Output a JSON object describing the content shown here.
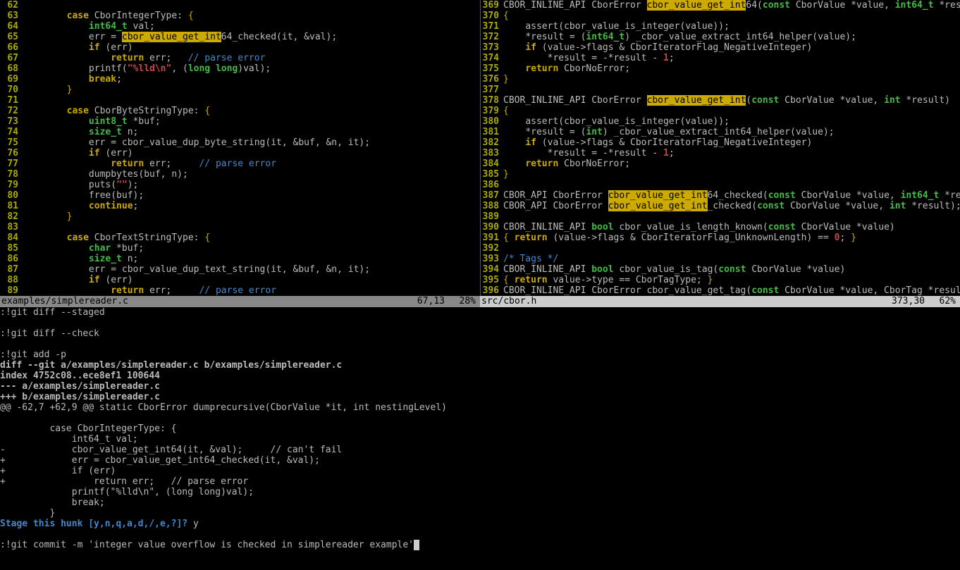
{
  "left": {
    "file": "examples/simplereader.c",
    "pos": "67,13",
    "pct": "28%",
    "lines": [
      {
        "n": 62,
        "t": ""
      },
      {
        "n": 63,
        "p": "        ",
        "tok": [
          [
            "c-keyword",
            "case"
          ],
          [
            "",
            " CborIntegerType: "
          ],
          [
            "c-paren",
            "{"
          ]
        ]
      },
      {
        "n": 64,
        "p": "            ",
        "tok": [
          [
            "c-type",
            "int64_t"
          ],
          [
            "",
            " val;"
          ]
        ]
      },
      {
        "n": 65,
        "p": "            ",
        "tok": [
          [
            "",
            "err = "
          ],
          [
            "c-hl",
            "cbor_value_get_int"
          ],
          [
            "",
            "64_checked(it, &val);"
          ]
        ]
      },
      {
        "n": 66,
        "p": "            ",
        "tok": [
          [
            "c-keyword",
            "if"
          ],
          [
            "",
            " (err)"
          ]
        ]
      },
      {
        "n": 67,
        "p": "                ",
        "tok": [
          [
            "c-keyword",
            "return"
          ],
          [
            "",
            " err;   "
          ],
          [
            "c-comment",
            "// parse error"
          ]
        ]
      },
      {
        "n": 68,
        "p": "            ",
        "tok": [
          [
            "",
            "printf("
          ],
          [
            "c-string",
            "\"%lld\\n\""
          ],
          [
            "",
            ", ("
          ],
          [
            "c-type",
            "long long"
          ],
          [
            "",
            ")val);"
          ]
        ]
      },
      {
        "n": 69,
        "p": "            ",
        "tok": [
          [
            "c-keyword",
            "break"
          ],
          [
            "",
            ";"
          ]
        ]
      },
      {
        "n": 70,
        "p": "        ",
        "tok": [
          [
            "c-paren",
            "}"
          ]
        ]
      },
      {
        "n": 71,
        "t": ""
      },
      {
        "n": 72,
        "p": "        ",
        "tok": [
          [
            "c-keyword",
            "case"
          ],
          [
            "",
            " CborByteStringType: "
          ],
          [
            "c-paren",
            "{"
          ]
        ]
      },
      {
        "n": 73,
        "p": "            ",
        "tok": [
          [
            "c-type",
            "uint8_t"
          ],
          [
            "",
            " *buf;"
          ]
        ]
      },
      {
        "n": 74,
        "p": "            ",
        "tok": [
          [
            "c-type",
            "size_t"
          ],
          [
            "",
            " n;"
          ]
        ]
      },
      {
        "n": 75,
        "p": "            ",
        "tok": [
          [
            "",
            "err = cbor_value_dup_byte_string(it, &buf, &n, it);"
          ]
        ]
      },
      {
        "n": 76,
        "p": "            ",
        "tok": [
          [
            "c-keyword",
            "if"
          ],
          [
            "",
            " (err)"
          ]
        ]
      },
      {
        "n": 77,
        "p": "                ",
        "tok": [
          [
            "c-keyword",
            "return"
          ],
          [
            "",
            " err;     "
          ],
          [
            "c-comment",
            "// parse error"
          ]
        ]
      },
      {
        "n": 78,
        "p": "            ",
        "tok": [
          [
            "",
            "dumpbytes(buf, n);"
          ]
        ]
      },
      {
        "n": 79,
        "p": "            ",
        "tok": [
          [
            "",
            "puts("
          ],
          [
            "c-string",
            "\"\""
          ],
          [
            "",
            ");"
          ]
        ]
      },
      {
        "n": 80,
        "p": "            ",
        "tok": [
          [
            "",
            "free(buf);"
          ]
        ]
      },
      {
        "n": 81,
        "p": "            ",
        "tok": [
          [
            "c-keyword",
            "continue"
          ],
          [
            "",
            ";"
          ]
        ]
      },
      {
        "n": 82,
        "p": "        ",
        "tok": [
          [
            "c-paren",
            "}"
          ]
        ]
      },
      {
        "n": 83,
        "t": ""
      },
      {
        "n": 84,
        "p": "        ",
        "tok": [
          [
            "c-keyword",
            "case"
          ],
          [
            "",
            " CborTextStringType: "
          ],
          [
            "c-paren",
            "{"
          ]
        ]
      },
      {
        "n": 85,
        "p": "            ",
        "tok": [
          [
            "c-type",
            "char"
          ],
          [
            "",
            " *buf;"
          ]
        ]
      },
      {
        "n": 86,
        "p": "            ",
        "tok": [
          [
            "c-type",
            "size_t"
          ],
          [
            "",
            " n;"
          ]
        ]
      },
      {
        "n": 87,
        "p": "            ",
        "tok": [
          [
            "",
            "err = cbor_value_dup_text_string(it, &buf, &n, it);"
          ]
        ]
      },
      {
        "n": 88,
        "p": "            ",
        "tok": [
          [
            "c-keyword",
            "if"
          ],
          [
            "",
            " (err)"
          ]
        ]
      },
      {
        "n": 89,
        "p": "                ",
        "tok": [
          [
            "c-keyword",
            "return"
          ],
          [
            "",
            " err;     "
          ],
          [
            "c-comment",
            "// parse error"
          ]
        ]
      }
    ]
  },
  "right": {
    "file": "src/cbor.h",
    "pos": "373,30",
    "pct": "62%",
    "lines": [
      {
        "n": 369,
        "p": "",
        "tok": [
          [
            "",
            "CBOR_INLINE_API CborError "
          ],
          [
            "c-hl",
            "cbor_value_get_int"
          ],
          [
            "",
            "64("
          ],
          [
            "c-type",
            "const"
          ],
          [
            "",
            " CborValue *value, "
          ],
          [
            "c-type",
            "int64_t"
          ],
          [
            "",
            " *result)"
          ]
        ]
      },
      {
        "n": 370,
        "p": "",
        "tok": [
          [
            "c-paren",
            "{"
          ]
        ]
      },
      {
        "n": 371,
        "p": "    ",
        "tok": [
          [
            "",
            "assert(cbor_value_is_integer(value));"
          ]
        ]
      },
      {
        "n": 372,
        "p": "    ",
        "tok": [
          [
            "",
            "*result = ("
          ],
          [
            "c-type",
            "int64_t"
          ],
          [
            "",
            ") _cbor_value_extract_int64_helper(value);"
          ]
        ]
      },
      {
        "n": 373,
        "p": "    ",
        "tok": [
          [
            "c-keyword",
            "if"
          ],
          [
            "",
            " (value->flags & CborIteratorFlag_NegativeInteger)"
          ]
        ]
      },
      {
        "n": 374,
        "p": "        ",
        "tok": [
          [
            "",
            "*result = -*result - "
          ],
          [
            "c-num",
            "1"
          ],
          [
            "",
            ";"
          ]
        ]
      },
      {
        "n": 375,
        "p": "    ",
        "tok": [
          [
            "c-keyword",
            "return"
          ],
          [
            "",
            " CborNoError;"
          ]
        ]
      },
      {
        "n": 376,
        "p": "",
        "tok": [
          [
            "c-paren",
            "}"
          ]
        ]
      },
      {
        "n": 377,
        "t": ""
      },
      {
        "n": 378,
        "p": "",
        "tok": [
          [
            "",
            "CBOR_INLINE_API CborError "
          ],
          [
            "c-hl",
            "cbor_value_get_int"
          ],
          [
            "",
            "("
          ],
          [
            "c-type",
            "const"
          ],
          [
            "",
            " CborValue *value, "
          ],
          [
            "c-type",
            "int"
          ],
          [
            "",
            " *result)"
          ]
        ]
      },
      {
        "n": 379,
        "p": "",
        "tok": [
          [
            "c-paren",
            "{"
          ]
        ]
      },
      {
        "n": 380,
        "p": "    ",
        "tok": [
          [
            "",
            "assert(cbor_value_is_integer(value));"
          ]
        ]
      },
      {
        "n": 381,
        "p": "    ",
        "tok": [
          [
            "",
            "*result = ("
          ],
          [
            "c-type",
            "int"
          ],
          [
            "",
            ") _cbor_value_extract_int64_helper(value);"
          ]
        ]
      },
      {
        "n": 382,
        "p": "    ",
        "tok": [
          [
            "c-keyword",
            "if"
          ],
          [
            "",
            " (value->flags & CborIteratorFlag_NegativeInteger)"
          ]
        ]
      },
      {
        "n": 383,
        "p": "        ",
        "tok": [
          [
            "",
            "*result = -*result - "
          ],
          [
            "c-num",
            "1"
          ],
          [
            "",
            ";"
          ]
        ]
      },
      {
        "n": 384,
        "p": "    ",
        "tok": [
          [
            "c-keyword",
            "return"
          ],
          [
            "",
            " CborNoError;"
          ]
        ]
      },
      {
        "n": 385,
        "p": "",
        "tok": [
          [
            "c-paren",
            "}"
          ]
        ]
      },
      {
        "n": 386,
        "t": ""
      },
      {
        "n": 387,
        "p": "",
        "tok": [
          [
            "",
            "CBOR_API CborError "
          ],
          [
            "c-hl",
            "cbor_value_get_int"
          ],
          [
            "",
            "64_checked("
          ],
          [
            "c-type",
            "const"
          ],
          [
            "",
            " CborValue *value, "
          ],
          [
            "c-type",
            "int64_t"
          ],
          [
            "",
            " *result);"
          ]
        ]
      },
      {
        "n": 388,
        "p": "",
        "tok": [
          [
            "",
            "CBOR_API CborError "
          ],
          [
            "c-hl",
            "cbor_value_get_int"
          ],
          [
            "",
            "_checked("
          ],
          [
            "c-type",
            "const"
          ],
          [
            "",
            " CborValue *value, "
          ],
          [
            "c-type",
            "int"
          ],
          [
            "",
            " *result);"
          ]
        ]
      },
      {
        "n": 389,
        "t": ""
      },
      {
        "n": 390,
        "p": "",
        "tok": [
          [
            "",
            "CBOR_INLINE_API "
          ],
          [
            "c-type",
            "bool"
          ],
          [
            "",
            " cbor_value_is_length_known("
          ],
          [
            "c-type",
            "const"
          ],
          [
            "",
            " CborValue *value)"
          ]
        ]
      },
      {
        "n": 391,
        "p": "",
        "tok": [
          [
            "c-paren",
            "{"
          ],
          [
            "",
            " "
          ],
          [
            "c-keyword",
            "return"
          ],
          [
            "",
            " (value->flags & CborIteratorFlag_UnknownLength) == "
          ],
          [
            "c-num",
            "0"
          ],
          [
            "",
            "; "
          ],
          [
            "c-paren",
            "}"
          ]
        ]
      },
      {
        "n": 392,
        "t": ""
      },
      {
        "n": 393,
        "p": "",
        "tok": [
          [
            "c-comment",
            "/* Tags */"
          ]
        ]
      },
      {
        "n": 394,
        "p": "",
        "tok": [
          [
            "",
            "CBOR_INLINE_API "
          ],
          [
            "c-type",
            "bool"
          ],
          [
            "",
            " cbor_value_is_tag("
          ],
          [
            "c-type",
            "const"
          ],
          [
            "",
            " CborValue *value)"
          ]
        ]
      },
      {
        "n": 395,
        "p": "",
        "tok": [
          [
            "c-paren",
            "{"
          ],
          [
            "",
            " "
          ],
          [
            "c-keyword",
            "return"
          ],
          [
            "",
            " value->type == CborTagType; "
          ],
          [
            "c-paren",
            "}"
          ]
        ]
      },
      {
        "n": 396,
        "p": "",
        "tok": [
          [
            "",
            "CBOR_INLINE_API CborError cbor_value_get_tag("
          ],
          [
            "c-type",
            "const"
          ],
          [
            "",
            " CborValue *value, CborTag *result)"
          ]
        ]
      }
    ]
  },
  "bottom": {
    "lines": [
      {
        "cls": "",
        "t": ":!git diff --staged"
      },
      {
        "cls": "",
        "t": ""
      },
      {
        "cls": "",
        "t": ":!git diff --check"
      },
      {
        "cls": "",
        "t": ""
      },
      {
        "cls": "",
        "t": ":!git add -p"
      },
      {
        "cls": "difffile",
        "t": "diff --git a/examples/simplereader.c b/examples/simplereader.c"
      },
      {
        "cls": "difffile",
        "t": "index 4752c08..ece8ef1 100644"
      },
      {
        "cls": "difffile",
        "t": "--- a/examples/simplereader.c"
      },
      {
        "cls": "difffile",
        "t": "+++ b/examples/simplereader.c"
      },
      {
        "cls": "diffhunk",
        "t": "@@ -62,7 +62,9 @@ static CborError dumprecursive(CborValue *it, int nestingLevel)"
      },
      {
        "cls": "",
        "t": ""
      },
      {
        "cls": "",
        "t": "         case CborIntegerType: {"
      },
      {
        "cls": "",
        "t": "             int64_t val;"
      },
      {
        "cls": "diffdel",
        "t": "-            cbor_value_get_int64(it, &val);     // can't fail"
      },
      {
        "cls": "diffadd",
        "t": "+            err = cbor_value_get_int64_checked(it, &val);"
      },
      {
        "cls": "diffadd",
        "t": "+            if (err)"
      },
      {
        "cls": "diffadd",
        "t": "+                return err;   // parse error"
      },
      {
        "cls": "",
        "t": "             printf(\"%lld\\n\", (long long)val);"
      },
      {
        "cls": "",
        "t": "             break;"
      },
      {
        "cls": "",
        "t": "         }"
      }
    ],
    "stage_prompt": "Stage this hunk [y,n,q,a,d,/,e,?]? ",
    "stage_answer": "y",
    "cmd": ":!git commit -m 'integer value overflow is checked in simplereader example'"
  }
}
